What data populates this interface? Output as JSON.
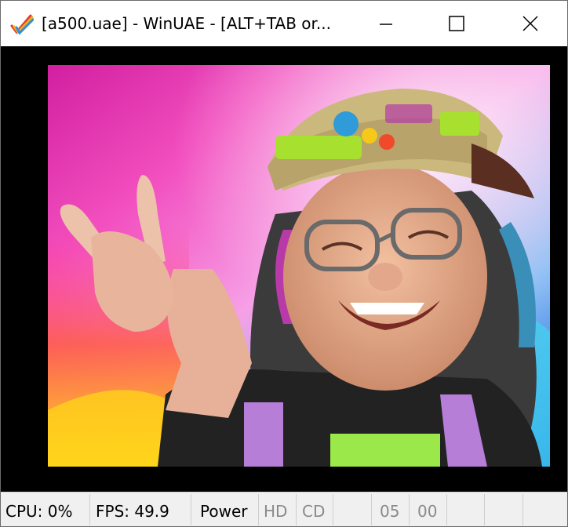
{
  "window": {
    "title": "[a500.uae] - WinUAE - [ALT+TAB or..."
  },
  "icons": {
    "app": "winuae-checkmark-icon",
    "minimize": "minimize-icon",
    "maximize": "maximize-icon",
    "close": "close-icon"
  },
  "display": {
    "content": "amiga-guru-illustration"
  },
  "statusbar": {
    "cpu": "CPU: 0%",
    "fps": "FPS: 49.9",
    "power": "Power",
    "hd": "HD",
    "cd": "CD",
    "df0": "05",
    "df1": "00"
  }
}
